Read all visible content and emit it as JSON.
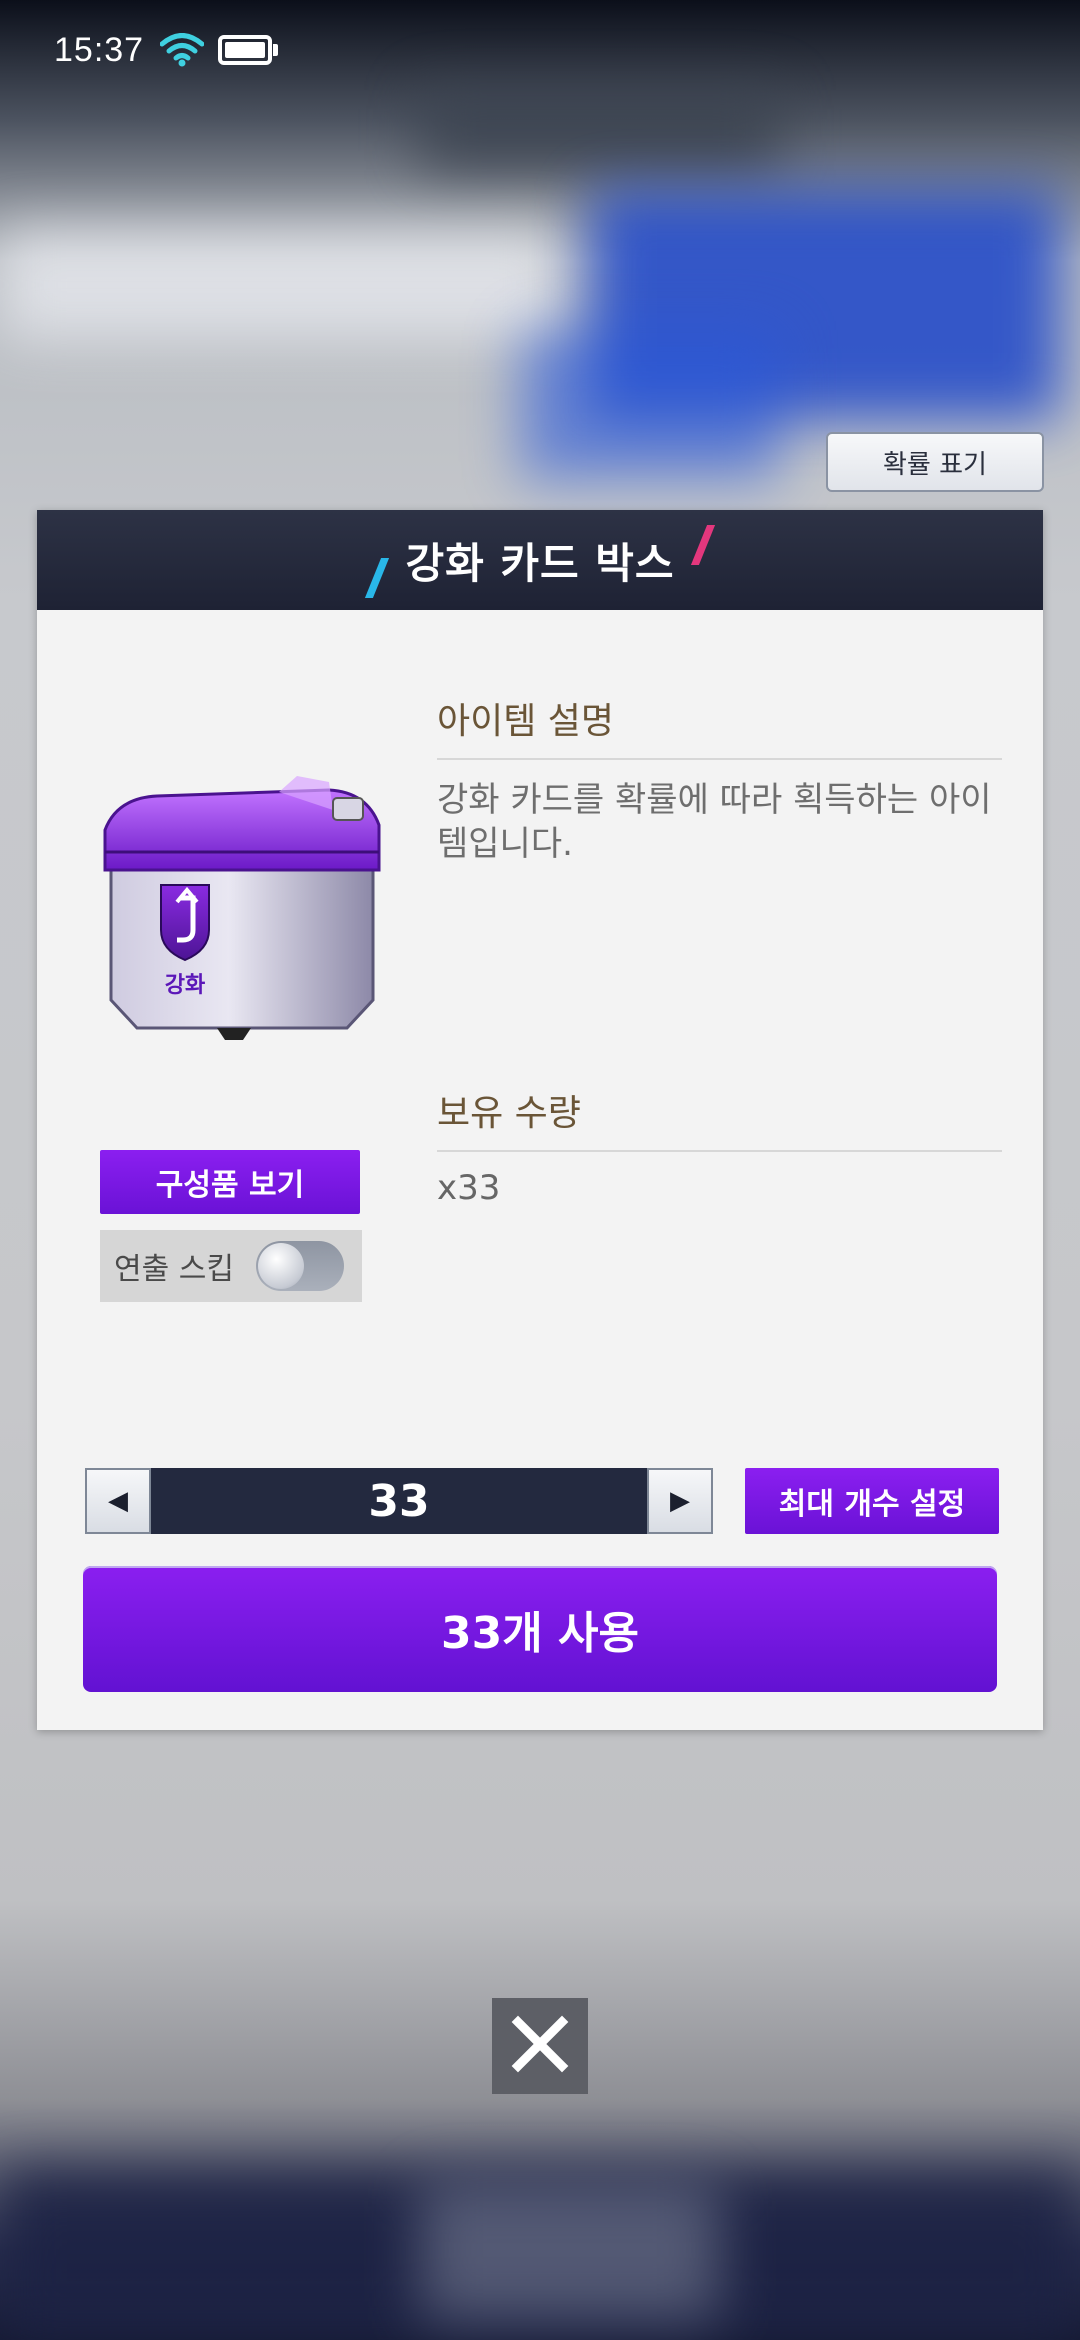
{
  "status_bar": {
    "time": "15:37"
  },
  "probability_button": {
    "label": "확률 표기"
  },
  "dialog": {
    "title": "강화 카드 박스",
    "item_badge_text": "강화",
    "description_title": "아이템 설명",
    "description_text": "강화 카드를 확률에 따라 획득하는 아이템입니다.",
    "owned_title": "보유 수량",
    "owned_value": "x33",
    "components_button": "구성품 보기",
    "skip_label": "연출 스킵",
    "skip_enabled": false,
    "quantity": "33",
    "max_button": "최대 개수 설정",
    "use_button": "33개 사용"
  },
  "colors": {
    "accent_purple": "#7b18e6",
    "header_dark": "#23293f",
    "title_brown": "#6a5537"
  },
  "icons": {
    "wifi": "wifi-icon",
    "battery": "battery-icon",
    "prev": "triangle-left-icon",
    "next": "triangle-right-icon",
    "close": "close-icon"
  }
}
